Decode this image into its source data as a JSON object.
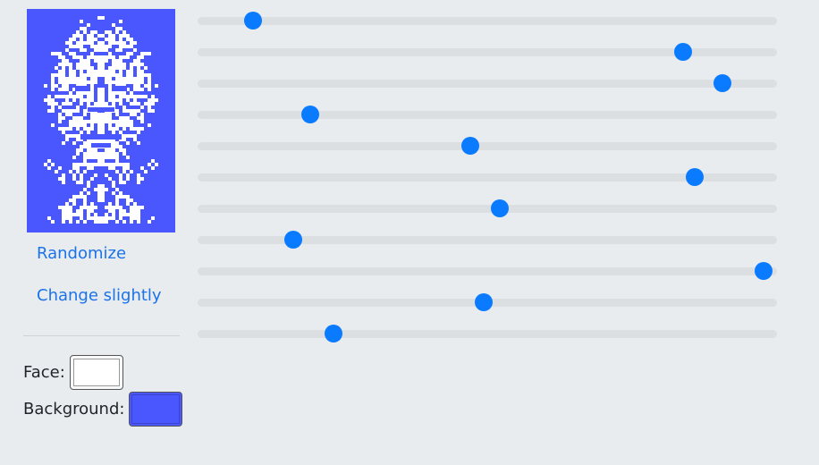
{
  "actions": {
    "randomize_label": "Randomize",
    "change_slightly_label": "Change slightly"
  },
  "colors": {
    "face_label": "Face:",
    "face_color": "#ffffff",
    "background_label": "Background:",
    "background_color": "#4a57ff",
    "accent": "#0a7bff"
  },
  "sliders": [
    {
      "name": "param-1",
      "value": 0.095
    },
    {
      "name": "param-2",
      "value": 0.838
    },
    {
      "name": "param-3",
      "value": 0.906
    },
    {
      "name": "param-4",
      "value": 0.195
    },
    {
      "name": "param-5",
      "value": 0.47
    },
    {
      "name": "param-6",
      "value": 0.858
    },
    {
      "name": "param-7",
      "value": 0.522
    },
    {
      "name": "param-8",
      "value": 0.165
    },
    {
      "name": "param-9",
      "value": 0.977
    },
    {
      "name": "param-10",
      "value": 0.494
    },
    {
      "name": "param-11",
      "value": 0.234
    }
  ]
}
